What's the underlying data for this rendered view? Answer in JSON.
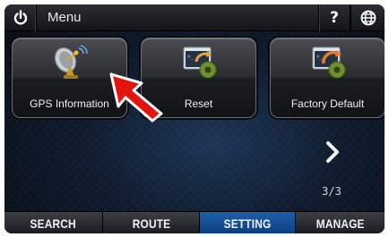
{
  "header": {
    "menu_title": "Menu",
    "help_label": "?",
    "icons": {
      "power": "power-icon",
      "globe": "globe-icon",
      "help": "help-icon"
    }
  },
  "tiles": [
    {
      "label": "GPS Information",
      "icon": "gps-satellite-icon"
    },
    {
      "label": "Reset",
      "icon": "reset-icon"
    },
    {
      "label": "Factory Default",
      "icon": "factory-default-icon"
    }
  ],
  "pager": {
    "indicator": "3/3",
    "next_icon": "chevron-right-icon"
  },
  "tabs": [
    {
      "label": "SEARCH",
      "active": false
    },
    {
      "label": "ROUTE",
      "active": false
    },
    {
      "label": "SETTING",
      "active": true
    },
    {
      "label": "MANAGE",
      "active": false
    }
  ],
  "annotation": {
    "icon": "red-pointer-arrow-icon",
    "color": "#e3140e"
  },
  "colors": {
    "active_tab": "#1560b0",
    "background": "#0f1b2d"
  }
}
